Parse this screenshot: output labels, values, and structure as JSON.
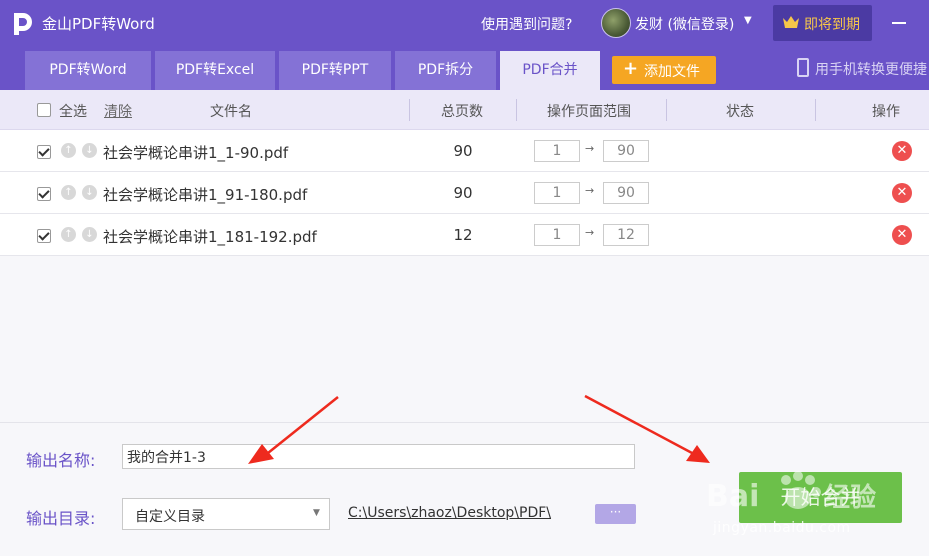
{
  "titlebar": {
    "app_title": "金山PDF转Word",
    "help_link": "使用遇到问题?",
    "user_name": "发财 (微信登录)",
    "vip_label": "即将到期"
  },
  "tabs": [
    {
      "label": "PDF转Word",
      "active": false
    },
    {
      "label": "PDF转Excel",
      "active": false
    },
    {
      "label": "PDF转PPT",
      "active": false
    },
    {
      "label": "PDF拆分",
      "active": false
    },
    {
      "label": "PDF合并",
      "active": true
    }
  ],
  "add_file_label": "添加文件",
  "phone_convert_label": "用手机转换更便捷",
  "table": {
    "select_all": "全选",
    "clear": "清除",
    "col_filename": "文件名",
    "col_total_pages": "总页数",
    "col_page_range": "操作页面范围",
    "col_status": "状态",
    "col_action": "操作",
    "rows": [
      {
        "checked": true,
        "filename": "社会学概论串讲1_1-90.pdf",
        "total_pages": "90",
        "range_from": "1",
        "range_to": "90"
      },
      {
        "checked": true,
        "filename": "社会学概论串讲1_91-180.pdf",
        "total_pages": "90",
        "range_from": "1",
        "range_to": "90"
      },
      {
        "checked": true,
        "filename": "社会学概论串讲1_181-192.pdf",
        "total_pages": "12",
        "range_from": "1",
        "range_to": "12"
      }
    ]
  },
  "output": {
    "name_label": "输出名称:",
    "name_value": "我的合并1-3",
    "dir_label": "输出目录:",
    "dir_option": "自定义目录",
    "dir_path": "C:\\Users\\zhaoz\\Desktop\\PDF\\",
    "more_button": "···",
    "start_button": "开始合并"
  },
  "watermark": {
    "text": "jingyan.baidu.com"
  },
  "colors": {
    "brand": "#6a53c8",
    "tab_active_bg": "#ebe8f8",
    "add_button": "#f5a623",
    "start_button": "#6cc04a",
    "delete": "#ee4f4f",
    "annotation_arrow": "#ee2a1e"
  },
  "icons": [
    "app-logo-icon",
    "avatar",
    "crown-icon",
    "minimize-icon",
    "plus-icon",
    "phone-icon",
    "move-up-icon",
    "move-down-icon",
    "delete-icon",
    "arrow-right-icon",
    "dropdown-caret-icon"
  ]
}
